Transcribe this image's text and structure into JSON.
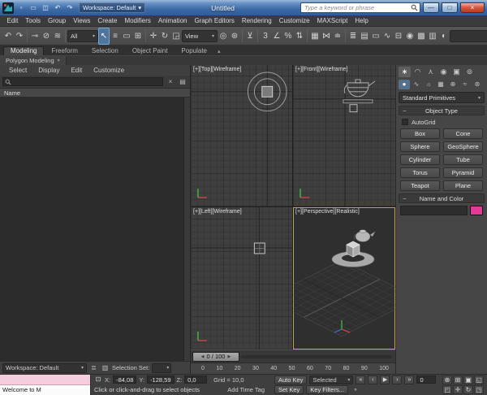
{
  "titlebar": {
    "workspace": "Workspace: Default",
    "title": "Untitled",
    "search_placeholder": "Type a keyword or phrase"
  },
  "menubar": {
    "items": [
      "Edit",
      "Tools",
      "Group",
      "Views",
      "Create",
      "Modifiers",
      "Animation",
      "Graph Editors",
      "Rendering",
      "Customize",
      "MAXScript",
      "Help"
    ]
  },
  "toolbar": {
    "filter_value": "All",
    "coord_value": "View"
  },
  "ribbon": {
    "tabs": [
      "Modeling",
      "Freeform",
      "Selection",
      "Object Paint",
      "Populate"
    ],
    "panel": "Polygon Modeling"
  },
  "explorer": {
    "menus": [
      "Select",
      "Display",
      "Edit",
      "Customize"
    ],
    "name_header": "Name"
  },
  "viewports": {
    "top": "[+][Top][Wireframe]",
    "front": "[+][Front][Wireframe]",
    "left": "[+][Left][Wireframe]",
    "perspective": "[+][Perspective][Realistic]"
  },
  "command_panel": {
    "category_dropdown": "Standard Primitives",
    "object_type": "Object Type",
    "autogrid": "AutoGrid",
    "buttons": [
      "Box",
      "Cone",
      "Sphere",
      "GeoSphere",
      "Cylinder",
      "Tube",
      "Torus",
      "Pyramid",
      "Teapot",
      "Plane"
    ],
    "name_and_color": "Name and Color",
    "swatch_style": "background:#e23a97"
  },
  "timeline": {
    "slider": "0 / 100",
    "ticks": [
      "0",
      "10",
      "20",
      "30",
      "40",
      "50",
      "60",
      "70",
      "80",
      "90",
      "100"
    ]
  },
  "statusbar": {
    "workspace": "Workspace: Default",
    "selection_set": "Selection Set:",
    "listener": "Welcome to M",
    "x_label": "X:",
    "x": "-84,08",
    "y_label": "Y:",
    "y": "-128,59",
    "z_label": "Z:",
    "z": "0,0",
    "grid": "Grid = 10,0",
    "prompt": "Click or click-and-drag to select objects",
    "add_time_tag": "Add Time Tag",
    "auto_key": "Auto Key",
    "selected": "Selected",
    "set_key": "Set Key",
    "key_filters": "Key Filters...",
    "frame": "0"
  },
  "colors": {
    "titlebar_blue": "#3b6aa6",
    "toolbar_selection_highlight": "#4f759c",
    "active_viewport_border": "#c9a43b",
    "object_color_swatch": "#e23a97"
  },
  "icons": {
    "new": "▫",
    "open": "▭",
    "save": "◫",
    "undo": "↶",
    "redo": "↷",
    "dropdown": "▾",
    "minimize": "—",
    "maximize": "□",
    "close": "×",
    "link": "⊸",
    "unlink": "⊘",
    "bind_spacewarp": "≋",
    "select": "↖",
    "select_by_name": "≡",
    "region": "▭",
    "window_crossing": "⊞",
    "move": "✛",
    "rotate": "↻",
    "scale": "◲",
    "pivot_center": "◎",
    "manipulate": "⊛",
    "kbd_override": "⊻",
    "snap": "3",
    "angle_snap": "∠",
    "percent_snap": "%",
    "spinner_snap": "⇅",
    "named_sets": "▦",
    "mirror": "⋈",
    "align": "≐",
    "scene_explorer": "≣",
    "layers": "▤",
    "ribbon_toggle": "▭",
    "curve_editor": "∿",
    "schematic": "⊟",
    "material": "◉",
    "render_setup": "▩",
    "rendered_frame": "▥",
    "render": "◐",
    "ribbon_min": "▴",
    "search_clear": "×",
    "columns": "▤",
    "tab_create": "∗",
    "tab_modify": "◠",
    "tab_hierarchy": "⋏",
    "tab_motion": "◉",
    "tab_display": "▣",
    "tab_utilities": "⊚",
    "cat_geometry": "●",
    "cat_shapes": "∿",
    "cat_lights": "☼",
    "cat_cameras": "▦",
    "cat_helpers": "⊕",
    "cat_spacewarps": "≈",
    "cat_systems": "⊛",
    "minus": "−",
    "slider_left": "◀",
    "slider_right": "▶",
    "lock": "⊡",
    "key_mode": "∘",
    "t_start": "«",
    "t_prev": "‹",
    "t_play": "▶",
    "t_next": "›",
    "t_end": "»",
    "nav_zoom": "⊕",
    "nav_zoom_all": "⊞",
    "nav_extents": "▣",
    "nav_extents_all": "◱",
    "nav_region": "◰",
    "nav_pan": "✛",
    "nav_orbit": "↻",
    "nav_maximize": "◳",
    "ws_explorer": "≣",
    "ws_display": "▥"
  }
}
